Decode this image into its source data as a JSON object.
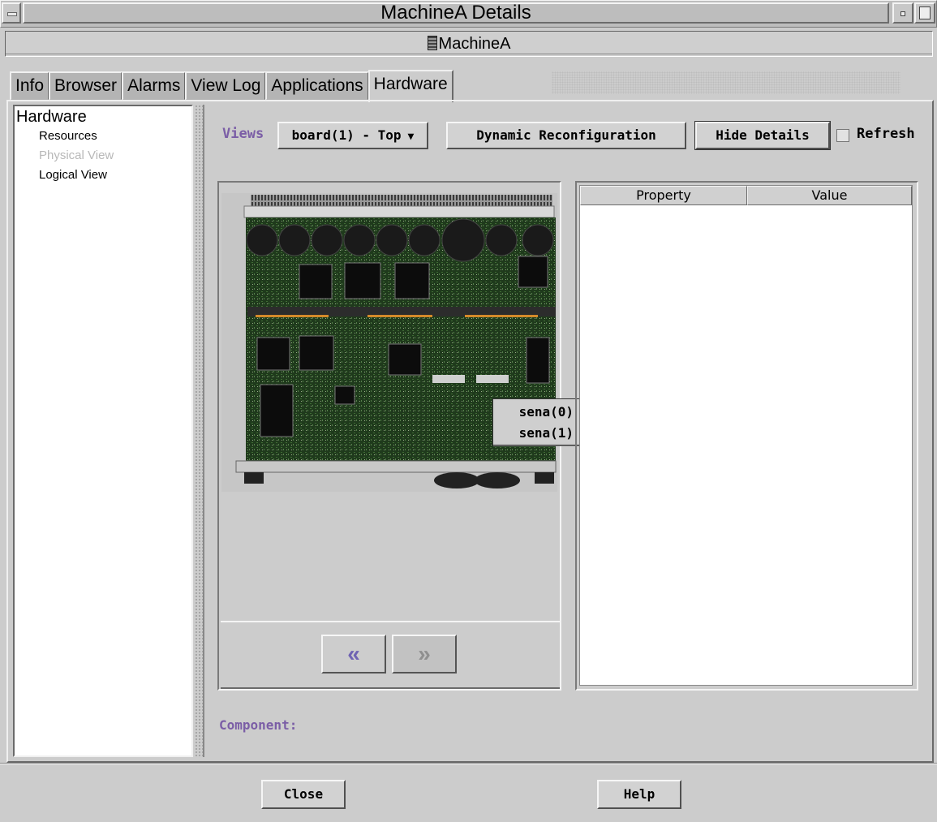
{
  "window": {
    "title": "MachineA Details",
    "machine_name": "MachineA"
  },
  "tabs": [
    {
      "label": "Info"
    },
    {
      "label": "Browser"
    },
    {
      "label": "Alarms"
    },
    {
      "label": "View Log"
    },
    {
      "label": "Applications"
    },
    {
      "label": "Hardware",
      "active": true
    }
  ],
  "tree": {
    "root": "Hardware",
    "items": [
      {
        "label": "Resources",
        "enabled": true
      },
      {
        "label": "Physical View",
        "enabled": false
      },
      {
        "label": "Logical View",
        "enabled": true
      }
    ]
  },
  "toolbar": {
    "views_label": "Views",
    "views_selected": "board(1) - Top",
    "dynamic_reconfig_label": "Dynamic Reconfiguration",
    "hide_details_label": "Hide Details",
    "refresh_label": "Refresh",
    "refresh_checked": false
  },
  "board_popup": {
    "items": [
      "sena(0)",
      "sena(1)"
    ]
  },
  "properties_table": {
    "columns": [
      "Property",
      "Value"
    ],
    "rows": []
  },
  "component": {
    "label": "Component:",
    "value": ""
  },
  "footer": {
    "close_label": "Close",
    "help_label": "Help"
  },
  "colors": {
    "window_bg": "#cccccc",
    "accent_label": "#7b5ea6",
    "nav_arrow": "#6f63b3"
  }
}
